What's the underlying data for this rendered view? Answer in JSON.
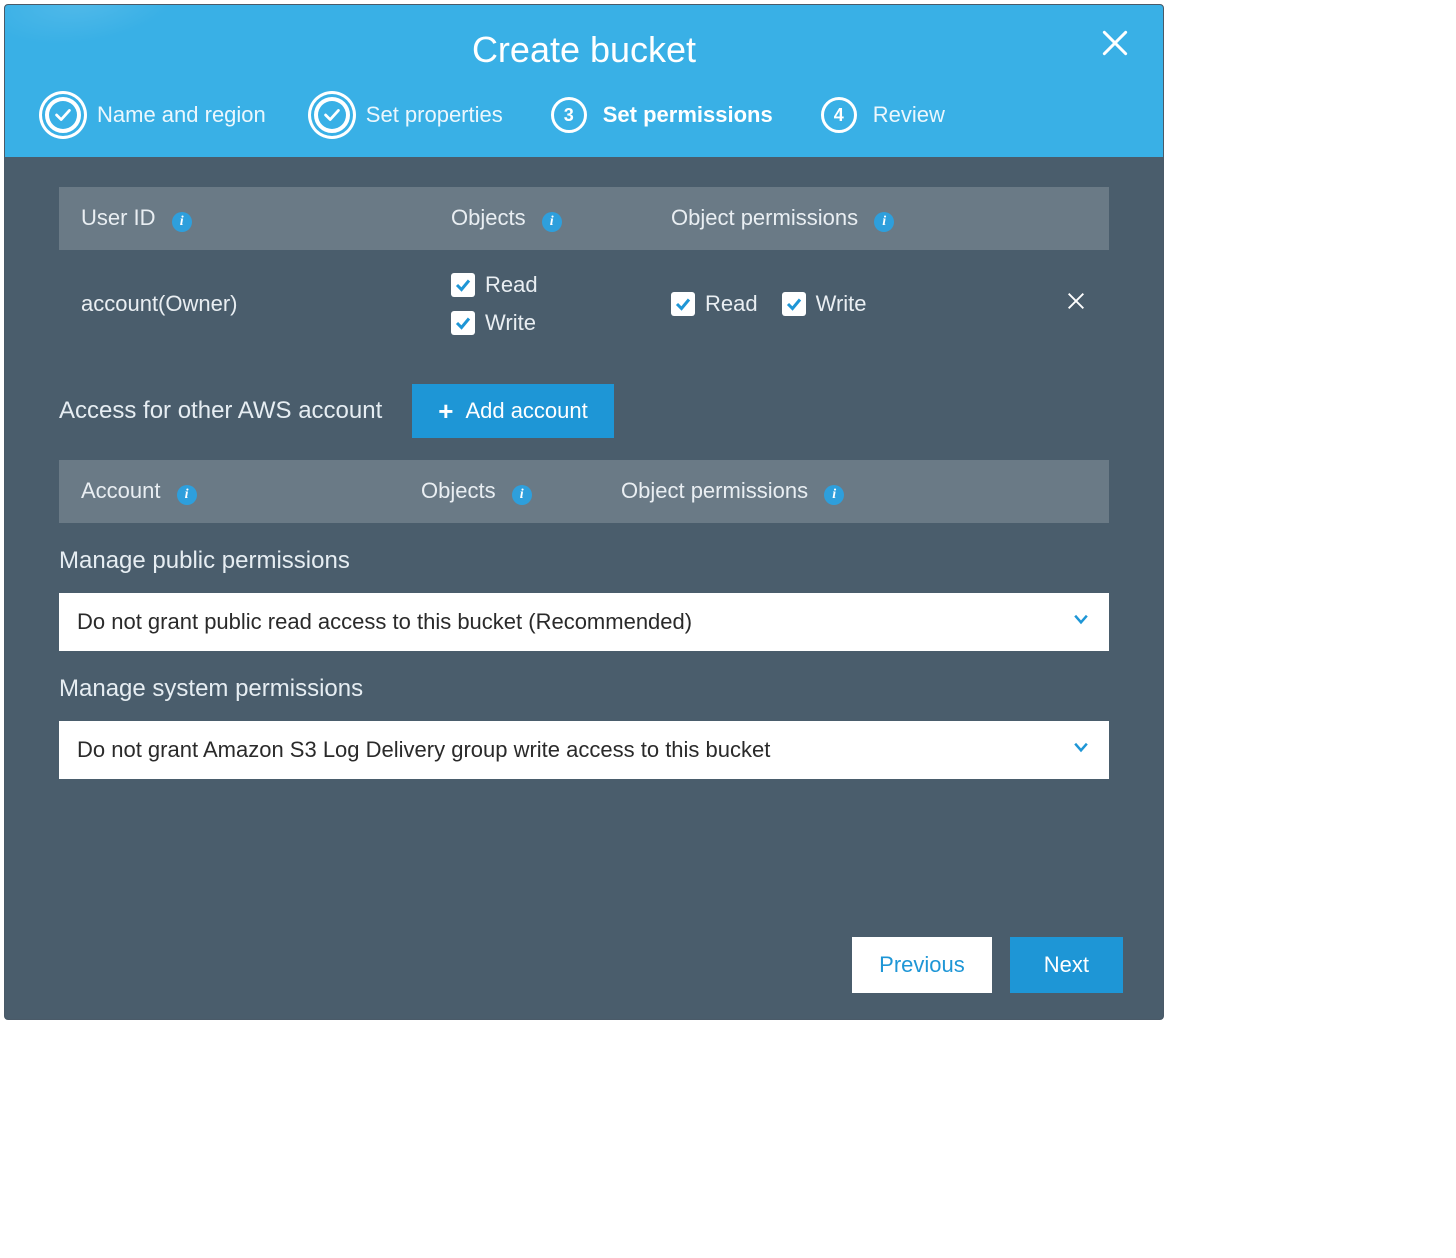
{
  "modal": {
    "title": "Create bucket",
    "close_label": "Close"
  },
  "steps": [
    {
      "label": "Name and region",
      "state": "done"
    },
    {
      "label": "Set properties",
      "state": "done"
    },
    {
      "label": "Set permissions",
      "state": "active",
      "number": "3"
    },
    {
      "label": "Review",
      "state": "pending",
      "number": "4"
    }
  ],
  "owner_table": {
    "headers": {
      "user": "User ID",
      "objects": "Objects",
      "objperm": "Object permissions"
    },
    "rows": [
      {
        "user": "account(Owner)",
        "objects_read": {
          "label": "Read",
          "checked": true
        },
        "objects_write": {
          "label": "Write",
          "checked": true
        },
        "perm_read": {
          "label": "Read",
          "checked": true
        },
        "perm_write": {
          "label": "Write",
          "checked": true
        }
      }
    ]
  },
  "other_accounts": {
    "label": "Access for other AWS account",
    "add_button": "Add account",
    "headers": {
      "account": "Account",
      "objects": "Objects",
      "objperm": "Object permissions"
    }
  },
  "public_permissions": {
    "title": "Manage public permissions",
    "selected": "Do not grant public read access to this bucket (Recommended)"
  },
  "system_permissions": {
    "title": "Manage system permissions",
    "selected": "Do not grant Amazon S3 Log Delivery group write access to this bucket"
  },
  "footer": {
    "previous": "Previous",
    "next": "Next"
  }
}
